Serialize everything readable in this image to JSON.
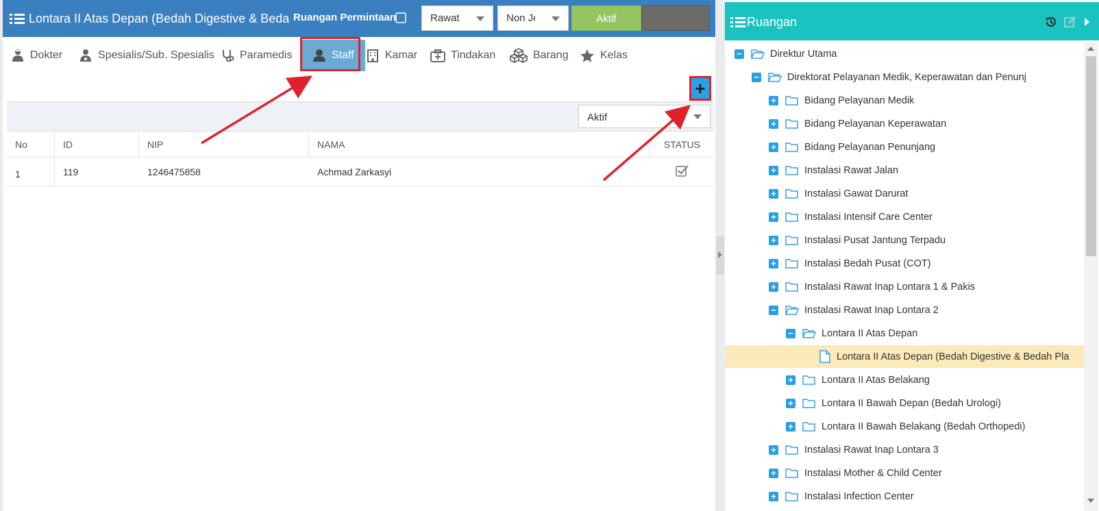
{
  "header": {
    "title": "Lontara II Atas Depan (Bedah Digestive & Bedah Pla",
    "ruangan_permintaan_label": "Ruangan Permintaan",
    "select_rawat": "Rawat",
    "select_jenis": "Non Je",
    "aktif_button": "Aktif"
  },
  "tabs": [
    {
      "label": "Dokter",
      "icon": "doctor-icon"
    },
    {
      "label": "Spesialis/Sub. Spesialis",
      "icon": "specialist-icon"
    },
    {
      "label": "Paramedis",
      "icon": "stethoscope-icon"
    },
    {
      "label": "Staff",
      "icon": "user-icon",
      "active": true
    },
    {
      "label": "Kamar",
      "icon": "hospital-building-icon"
    },
    {
      "label": "Tindakan",
      "icon": "medkit-icon"
    },
    {
      "label": "Barang",
      "icon": "cubes-icon"
    },
    {
      "label": "Kelas",
      "icon": "star-icon"
    }
  ],
  "add_button": "+",
  "filter": {
    "status_value": "Aktif"
  },
  "table": {
    "columns": [
      "No",
      "ID",
      "NIP",
      "NAMA",
      "STATUS"
    ],
    "rows": [
      {
        "no": "1",
        "id": "119",
        "nip": "1246475858",
        "nama": "Achmad Zarkasyi",
        "status_checked": true
      }
    ]
  },
  "tree": {
    "title": "Ruangan",
    "nodes": [
      {
        "label": "Direktur Utama",
        "level": 0,
        "state": "expanded"
      },
      {
        "label": "Direktorat Pelayanan Medik, Keperawatan dan Penunj",
        "level": 1,
        "state": "expanded"
      },
      {
        "label": "Bidang Pelayanan Medik",
        "level": 2,
        "state": "collapsed"
      },
      {
        "label": "Bidang Pelayanan Keperawatan",
        "level": 2,
        "state": "collapsed"
      },
      {
        "label": "Bidang Pelayanan Penunjang",
        "level": 2,
        "state": "collapsed"
      },
      {
        "label": "Instalasi Rawat Jalan",
        "level": 2,
        "state": "collapsed"
      },
      {
        "label": "Instalasi Gawat Darurat",
        "level": 2,
        "state": "collapsed"
      },
      {
        "label": "Instalasi Intensif Care Center",
        "level": 2,
        "state": "collapsed"
      },
      {
        "label": "Instalasi Pusat Jantung Terpadu",
        "level": 2,
        "state": "collapsed"
      },
      {
        "label": "Instalasi Bedah Pusat (COT)",
        "level": 2,
        "state": "collapsed"
      },
      {
        "label": "Instalasi Rawat Inap Lontara 1 & Pakis",
        "level": 2,
        "state": "collapsed"
      },
      {
        "label": "Instalasi Rawat Inap Lontara 2",
        "level": 2,
        "state": "expanded"
      },
      {
        "label": "Lontara II Atas Depan",
        "level": 3,
        "state": "expanded"
      },
      {
        "label": "Lontara II Atas Depan (Bedah Digestive & Bedah Pla",
        "level": 4,
        "state": "leaf",
        "selected": true
      },
      {
        "label": "Lontara II Atas Belakang",
        "level": 3,
        "state": "collapsed"
      },
      {
        "label": "Lontara II Bawah Depan (Bedah Urologi)",
        "level": 3,
        "state": "collapsed"
      },
      {
        "label": "Lontara II Bawah Belakang (Bedah Orthopedi)",
        "level": 3,
        "state": "collapsed"
      },
      {
        "label": "Instalasi Rawat Inap Lontara 3",
        "level": 2,
        "state": "collapsed"
      },
      {
        "label": "Instalasi Mother & Child Center",
        "level": 2,
        "state": "collapsed"
      },
      {
        "label": "Instalasi Infection Center",
        "level": 2,
        "state": "collapsed"
      }
    ]
  },
  "colors": {
    "left_header": "#3a7fbf",
    "right_header": "#1bc3c0",
    "active_tab": "#6aaad4",
    "aktif_button": "#94c562",
    "tree_toggle": "#2a9fe2",
    "selected_row": "#fbe9b7",
    "annotation": "#e0202a"
  }
}
